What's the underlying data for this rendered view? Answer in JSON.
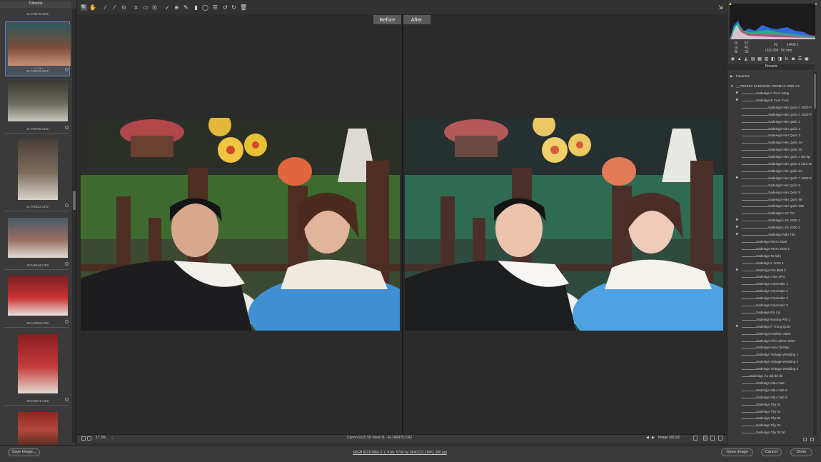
{
  "filmstrip": {
    "title": "Filmstrip",
    "top_name": "4L7A0175.CR2",
    "items": [
      {
        "name": "4L7A0975.CR2",
        "stars": "• • • • •",
        "colors": [
          "#2f5a5c",
          "#7a4b3b",
          "#c98f77"
        ]
      },
      {
        "name": "4L7A0765.CR2",
        "colors": [
          "#3c3a32",
          "#6b6a5e",
          "#c9c7bf"
        ]
      },
      {
        "name": "4L7A0163.CR2",
        "colors": [
          "#4a4038",
          "#7d6c5c",
          "#d9d3cc"
        ]
      },
      {
        "name": "4N7A0169.CR2",
        "colors": [
          "#4a5a6a",
          "#9a6e62",
          "#e0d9d4"
        ]
      },
      {
        "name": "4N7A0265.CR2",
        "colors": [
          "#7a1f1f",
          "#c93232",
          "#e6e0dc"
        ]
      },
      {
        "name": "4N7A0271.CR2",
        "colors": [
          "#8a1d22",
          "#c63b3b",
          "#e3dad3"
        ]
      },
      {
        "name": "",
        "colors": [
          "#8a2a22",
          "#b5473d",
          "#5a3020"
        ]
      }
    ]
  },
  "toolbar": {
    "icons": [
      "zoom-icon",
      "hand-icon",
      "white-balance-icon",
      "color-sampler-icon",
      "targeted-adjustment-icon",
      "crop-icon",
      "straighten-icon",
      "transform-icon",
      "spot-removal-icon",
      "red-eye-icon",
      "adjustment-brush-icon",
      "graduated-filter-icon",
      "radial-filter-icon",
      "preferences-icon",
      "rotate-left-icon",
      "rotate-right-icon",
      "trash-icon"
    ],
    "glyphs": [
      "🔍",
      "✋",
      "⁄",
      "⁄",
      "⊙",
      "⌗",
      "▭",
      "⊡",
      "✓",
      "⊕",
      "✎",
      "▮",
      "◯",
      "☰",
      "↺",
      "↻",
      "🗑"
    ],
    "fullscreen_glyph": "⇲"
  },
  "compare": {
    "before": "Before",
    "after": "After"
  },
  "status_bar": {
    "zoom": "17.3%",
    "camera": "Canon EOS 5D Mark III",
    "separator": "-",
    "file": "4L7A0975.CR2",
    "image_count": "Image 68/160"
  },
  "footer": {
    "save": "Save Image...",
    "workflow": "sRGB IEC61966-2.1; 8 bit; 5760 by 3840 (22.1MP); 300 ppi",
    "open": "Open Image",
    "cancel": "Cancel",
    "done": "Done"
  },
  "info": {
    "r_label": "R:",
    "r": "57",
    "g_label": "G:",
    "g": "41",
    "b_label": "B:",
    "b": "32",
    "aperture": "f/2",
    "shutter": "1/400 s",
    "iso": "ISO 200",
    "focal": "50 mm"
  },
  "panel_icon_glyphs": [
    "◉",
    "▲",
    "◭",
    "▤",
    "▦",
    "▥",
    "◧",
    "◨",
    "fx",
    "◙",
    "☰",
    "▣"
  ],
  "presets": {
    "title": "Presets",
    "favorites": "Favorites",
    "folder": "__PRESET SADESIGN PROMAX 2020 V.2",
    "items": [
      {
        "label": "Sadesign A Tươi Sáng",
        "star": true
      },
      {
        "label": "Sadesign B  Cam Tươi",
        "star": true
      },
      {
        "label": "Sadesign Hàn Quốc 0 2020 Pro",
        "star": false
      },
      {
        "label": "Sadesign Hàn Quốc 0 2020 Pro 2",
        "star": false
      },
      {
        "label": "Sadesign Hàn Quốc 1",
        "star": false
      },
      {
        "label": "Sadesign Hàn Quốc 2",
        "star": false
      },
      {
        "label": "Sadesign Hàn Quốc 3",
        "star": false
      },
      {
        "label": "Sadesign Hàn Quốc 3A",
        "star": false
      },
      {
        "label": "Sadesign Hàn Quốc 3C",
        "star": false
      },
      {
        "label": "Sadesign Hàn Quốc 4 ấm áp",
        "star": false
      },
      {
        "label": "Sadesign Hàn Quốc 5 nâu nhẹ",
        "star": false
      },
      {
        "label": "Sadesign Hàn Quốc 6A",
        "star": false
      },
      {
        "label": "Sadesign Hàn Quốc 7 2020 Pro 2",
        "star": true
      },
      {
        "label": "Sadesign Hàn Quốc 8",
        "star": false
      },
      {
        "label": "Sadesign Hàn Quốc 9",
        "star": false
      },
      {
        "label": "Sadesign Hàn Quốc 99",
        "star": false
      },
      {
        "label": "Sadesign Hàn Quốc 999",
        "star": false
      },
      {
        "label": "Sadesign LXC  TH",
        "star": false
      },
      {
        "label": "Sadesign LXS 2020 1",
        "star": true
      },
      {
        "label": "Sadesign LXS 2020 3",
        "star": true
      },
      {
        "label": "Sadesign Nâu Tây",
        "star": true
      },
      {
        "label": "Sadesign Retro 2020",
        "star": false
      },
      {
        "label": "Sadesign Retro 2020 2",
        "star": false
      },
      {
        "label": "Sadesign Ta hiện",
        "star": false
      },
      {
        "label": "Sadesign  F 2020 2",
        "star": false
      },
      {
        "label": "Sadesign  Pro 8Bitt 2",
        "star": true
      },
      {
        "label": "Sadesign A Be 3PG",
        "star": false
      },
      {
        "label": "Sadesign Cinematic 1",
        "star": false
      },
      {
        "label": "Sadesign Cinematic 2",
        "star": false
      },
      {
        "label": "Sadesign Cinematic 3",
        "star": false
      },
      {
        "label": "Sadesign Cinematic 3",
        "star": false
      },
      {
        "label": "Sadesign Đà Lạt",
        "star": false
      },
      {
        "label": "Sadesign Đường Phố 1",
        "star": false
      },
      {
        "label": "Sadesign F Trung Quốc",
        "star": true
      },
      {
        "label": "Sadesign Fashion 2020",
        "star": false
      },
      {
        "label": "Sadesign Film JaPan 2020",
        "star": false
      },
      {
        "label": "Sadesign Hoa Cải Đẹp",
        "star": false
      },
      {
        "label": "Sadesign Vintage Wedding 1",
        "star": false
      },
      {
        "label": "Sadesign Vintage Wedding 2",
        "star": false
      },
      {
        "label": "Sadesign Vintage Wedding 3",
        "star": false
      },
      {
        "label": "Sadesign Áo dài đỏ đỏ",
        "star": false
      },
      {
        "label": "Sadesign Nâu Cafe",
        "star": false
      },
      {
        "label": "Sadesign Nâu Cafe 2",
        "star": false
      },
      {
        "label": "Sadesign Nâu Cafe 3",
        "star": false
      },
      {
        "label": "Sadesign Tây 01",
        "star": false
      },
      {
        "label": "Sadesign Tây 02",
        "star": false
      },
      {
        "label": "Sadesign Tây 03",
        "star": false
      },
      {
        "label": "Sadesign Tây 04",
        "star": false
      },
      {
        "label": "Sadesign Tây 05 W",
        "star": false
      }
    ]
  }
}
